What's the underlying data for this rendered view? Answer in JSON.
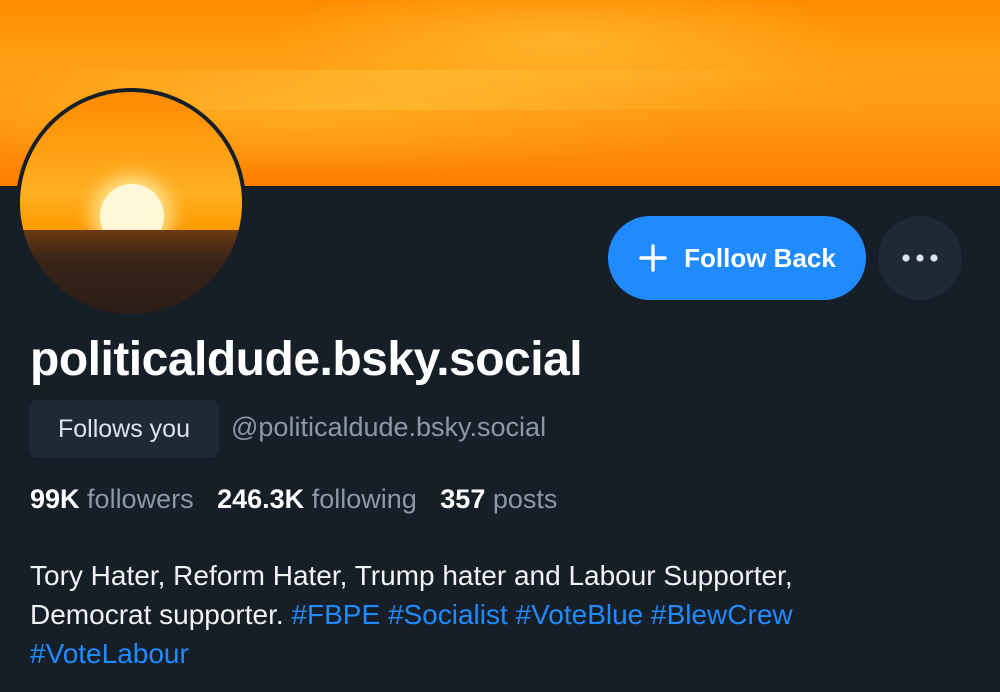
{
  "profile": {
    "display_name": "politicaldude.bsky.social",
    "handle": "@politicaldude.bsky.social",
    "follows_you_label": "Follows you",
    "follow_back_label": "Follow Back",
    "stats": {
      "followers_count": "99K",
      "followers_label": "followers",
      "following_count": "246.3K",
      "following_label": "following",
      "posts_count": "357",
      "posts_label": "posts"
    },
    "bio": {
      "line1": "Tory Hater, Reform Hater, Trump hater and Labour Supporter,",
      "line2_text": "Democrat supporter.",
      "hashtags": [
        "#FBPE",
        "#Socialist",
        "#VoteBlue",
        "#BlewCrew",
        "#VoteLabour"
      ]
    }
  },
  "colors": {
    "background": "#161e27",
    "accent": "#208bfe",
    "muted_text": "#8b98a5",
    "secondary_surface": "#1e2936",
    "banner": "#ff9a10"
  },
  "icons": {
    "follow": "plus-icon",
    "more": "more-dots-icon"
  }
}
